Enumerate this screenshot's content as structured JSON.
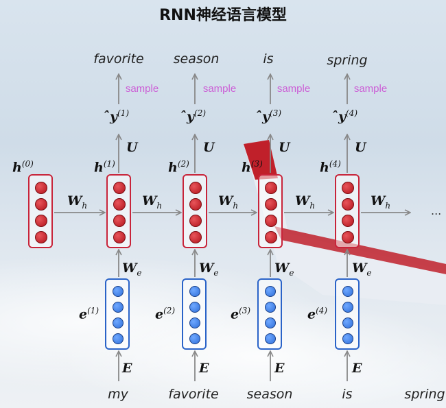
{
  "title": "RNN神经语言模型",
  "outputs": [
    "favorite",
    "season",
    "is",
    "spring"
  ],
  "inputs": [
    "my",
    "favorite",
    "season",
    "is",
    "spring"
  ],
  "sample_label": "sample",
  "h0_label": "h",
  "h0_sup": "(0)",
  "steps": [
    {
      "h_sup": "(1)",
      "y_sup": "(1)",
      "e_sup": "(1)"
    },
    {
      "h_sup": "(2)",
      "y_sup": "(2)",
      "e_sup": "(2)"
    },
    {
      "h_sup": "(3)",
      "y_sup": "(3)",
      "e_sup": "(3)"
    },
    {
      "h_sup": "(4)",
      "y_sup": "(4)",
      "e_sup": "(4)"
    }
  ],
  "labels": {
    "h": "h",
    "y": "y",
    "e": "e",
    "U": "U",
    "E": "E",
    "W": "W",
    "Wh_sub": "h",
    "We_sub": "e"
  },
  "ellipsis": "...",
  "colors": {
    "hidden_border": "#c8243a",
    "hidden_dot": "#b3141d",
    "embed_border": "#2a63c8",
    "embed_dot": "#2f6fd9",
    "sample": "#cc5fd6",
    "wing": "#c0202a"
  }
}
